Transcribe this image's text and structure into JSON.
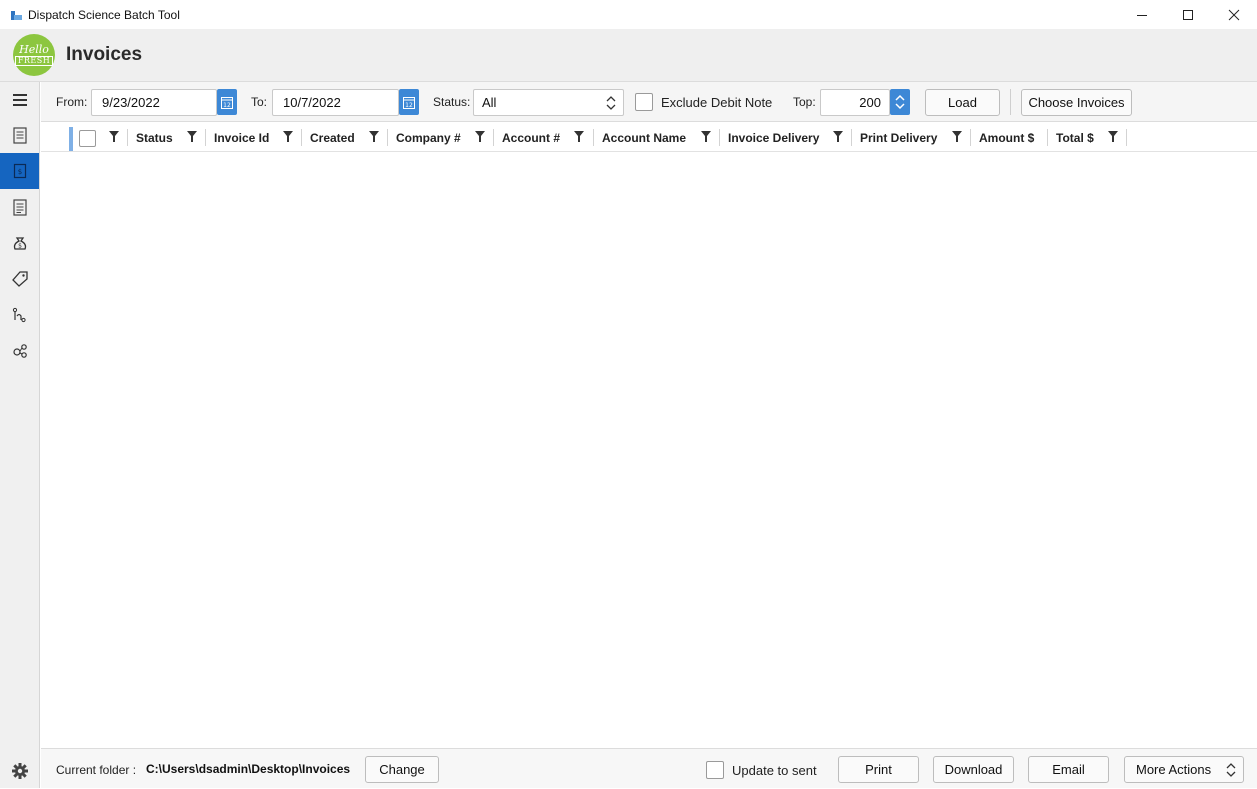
{
  "window": {
    "title": "Dispatch Science Batch Tool"
  },
  "header": {
    "logo_line1": "Hello",
    "logo_line2": "FRESH",
    "title": "Invoices"
  },
  "toolbar": {
    "from_label": "From:",
    "from_value": "9/23/2022",
    "to_label": "To:",
    "to_value": "10/7/2022",
    "status_label": "Status:",
    "status_value": "All",
    "exclude_debit_label": "Exclude Debit Note",
    "exclude_debit_checked": false,
    "top_label": "Top:",
    "top_value": "200",
    "load_label": "Load",
    "choose_invoices_label": "Choose Invoices"
  },
  "grid": {
    "columns": [
      "Status",
      "Invoice Id",
      "Created",
      "Company #",
      "Account #",
      "Account Name",
      "Invoice Delivery",
      "Print Delivery",
      "Amount $",
      "Total $"
    ],
    "rows": []
  },
  "footer": {
    "current_folder_label": "Current folder :",
    "current_folder_path": "C:\\Users\\dsadmin\\Desktop\\Invoices",
    "change_label": "Change",
    "update_to_sent_label": "Update to sent",
    "update_to_sent_checked": false,
    "print_label": "Print",
    "download_label": "Download",
    "email_label": "Email",
    "more_actions_label": "More Actions"
  },
  "nav": {
    "items": [
      "menu-icon",
      "document-list-icon",
      "invoice-icon",
      "notes-icon",
      "money-bag-icon",
      "price-tag-icon",
      "route-icon",
      "workflow-icon"
    ],
    "active": "invoice-icon",
    "settings": "gear-icon"
  },
  "colors": {
    "accent": "#1565c0",
    "spin_blue": "#3d88d6",
    "logo_green": "#8cc63f"
  }
}
